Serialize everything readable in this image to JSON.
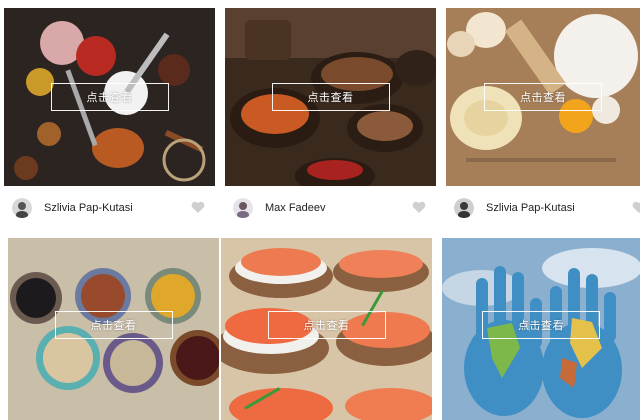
{
  "cards": [
    {
      "button": "点击查看",
      "author": "Szlivia Pap-Kutasi",
      "icon": "heart-icon",
      "avatar": "user-avatar"
    },
    {
      "button": "点击查看",
      "author": "Max Fadeev",
      "icon": "heart-icon",
      "avatar": "user-avatar"
    },
    {
      "button": "点击查看",
      "author": "Szlivia Pap-Kutasi",
      "icon": "heart-icon",
      "avatar": "user-avatar"
    },
    {
      "button": "点击查看"
    },
    {
      "button": "点击查看"
    },
    {
      "button": "点击查看"
    }
  ],
  "colors": {
    "text": "#222222",
    "heart": "#cfcfcf",
    "overlay_border": "#ffffff"
  }
}
